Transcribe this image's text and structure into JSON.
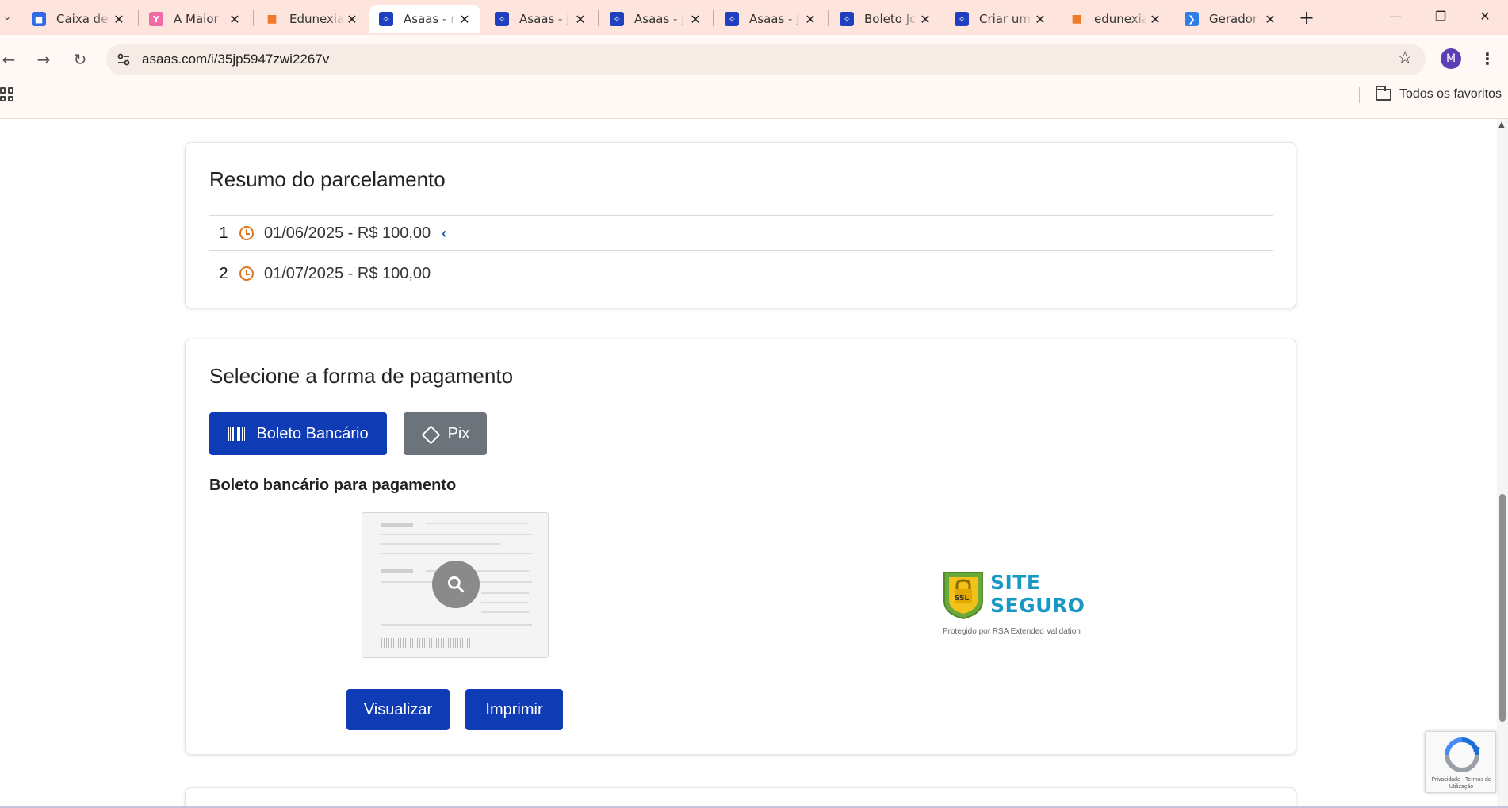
{
  "browser": {
    "tabs": [
      {
        "title": "Caixa de",
        "favicon_color": "#2f6be6"
      },
      {
        "title": "A Maior",
        "favicon_color": "#f06aa6"
      },
      {
        "title": "Edunexia",
        "favicon_color": "#f07a2a"
      },
      {
        "title": "Asaas - r",
        "favicon_color": "#1e3fbf",
        "active": true
      },
      {
        "title": "Asaas - j",
        "favicon_color": "#1e3fbf"
      },
      {
        "title": "Asaas - j",
        "favicon_color": "#1e3fbf"
      },
      {
        "title": "Asaas - J",
        "favicon_color": "#1e3fbf"
      },
      {
        "title": "Boleto Jc",
        "favicon_color": "#1e3fbf"
      },
      {
        "title": "Criar um",
        "favicon_color": "#1e3fbf"
      },
      {
        "title": "edunexia",
        "favicon_color": "#f07a2a"
      },
      {
        "title": "Gerador",
        "favicon_color": "#2f7fe6"
      }
    ],
    "url": "asaas.com/i/35jp5947zwi2267v",
    "profile_initial": "M",
    "bookmarks_all_label": "Todos os favoritos"
  },
  "summary": {
    "title": "Resumo do parcelamento",
    "installments": [
      {
        "number": "1",
        "text": "01/06/2025 - R$ 100,00",
        "current": true
      },
      {
        "number": "2",
        "text": "01/07/2025 - R$ 100,00",
        "current": false
      }
    ]
  },
  "payment": {
    "title": "Selecione a forma de pagamento",
    "methods": {
      "boleto": "Boleto Bancário",
      "pix": "Pix"
    },
    "subtitle": "Boleto bancário para pagamento",
    "view_button": "Visualizar",
    "print_button": "Imprimir",
    "seal": {
      "line1": "SITE",
      "line2": "SEGURO",
      "badge": "SSL",
      "caption": "Protegido por RSA Extended Validation"
    }
  },
  "recaptcha": {
    "links": "Privacidade - Termos de Utilização"
  },
  "colors": {
    "primary": "#0f3bb5",
    "pix_gray": "#6c737a",
    "clock": "#e0751b",
    "seal_blue": "#1a98c4",
    "tab_bar": "#fde4dc"
  }
}
